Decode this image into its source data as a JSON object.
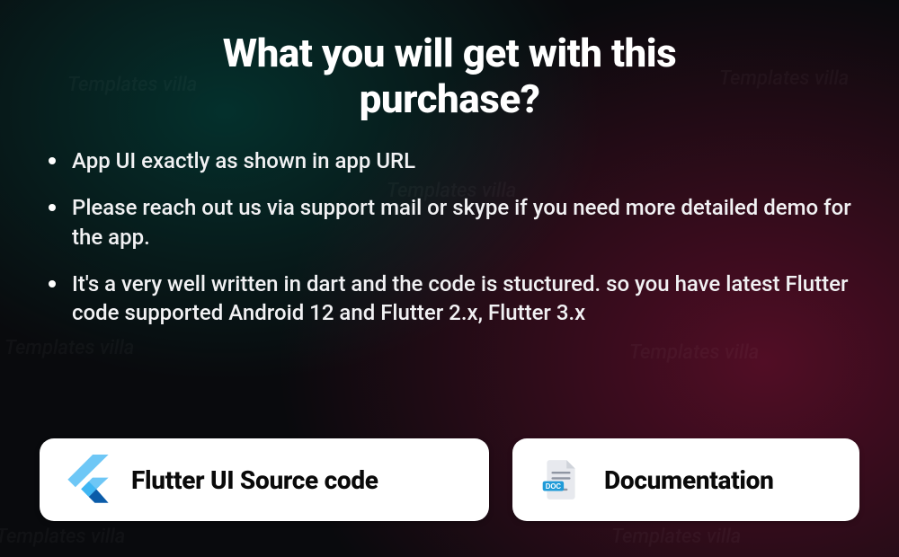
{
  "watermark": "Templates villa",
  "heading": "What you will get with this purchase?",
  "bullets": [
    "App UI exactly as shown in app URL",
    "Please reach out us via support mail or skype if you need more detailed demo for the app.",
    "It's a very well written in dart and the code is stuctured. so you have latest Flutter code supported Android 12  and Flutter 2.x, Flutter 3.x"
  ],
  "cards": {
    "source": {
      "label": "Flutter UI Source code"
    },
    "docs": {
      "label": "Documentation"
    }
  },
  "colors": {
    "flutter_dark": "#0b5ca9",
    "flutter_mid": "#3fb6f3",
    "flutter_light": "#6ec7f6",
    "doc_badge": "#1f9bd8",
    "doc_paper": "#e7e9ee",
    "doc_lines": "#8f96a3"
  }
}
